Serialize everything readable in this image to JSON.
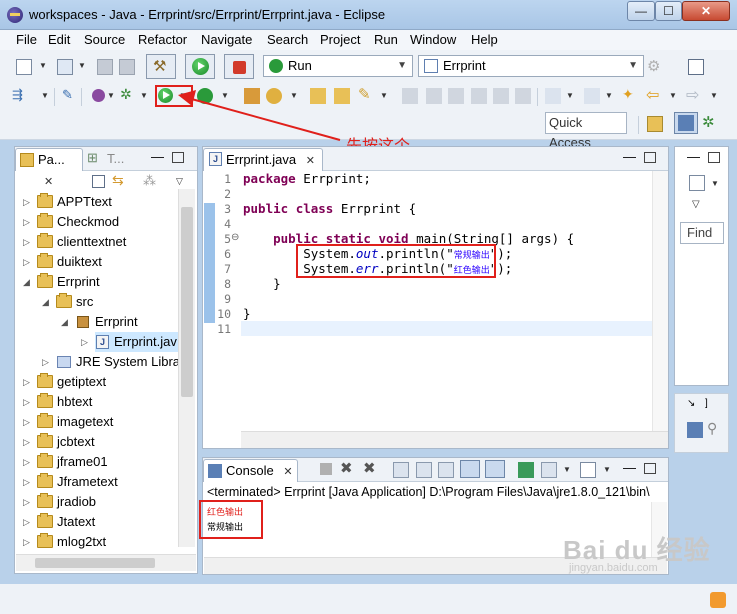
{
  "window": {
    "title": "workspaces - Java - Errprint/src/Errprint/Errprint.java - Eclipse",
    "min_glyph": "—",
    "max_glyph": "☐",
    "close_glyph": "✕"
  },
  "menubar": {
    "items": [
      "File",
      "Edit",
      "Source",
      "Refactor",
      "Navigate",
      "Search",
      "Project",
      "Run",
      "Window",
      "Help"
    ]
  },
  "toolbar": {
    "run_config_label": "Run",
    "launch_target_label": "Errprint",
    "quick_access_label": "Quick Access"
  },
  "package_explorer": {
    "tab_label": "Pa...",
    "secondary_tab_label": "T...",
    "items": [
      {
        "label": "APPTtext"
      },
      {
        "label": "Checkmod"
      },
      {
        "label": "clienttextnet"
      },
      {
        "label": "duiktext"
      },
      {
        "label": "Errprint"
      },
      {
        "label": "src"
      },
      {
        "label": "Errprint"
      },
      {
        "label": "Errprint.jav"
      },
      {
        "label": "JRE System Librar"
      },
      {
        "label": "getiptext"
      },
      {
        "label": "hbtext"
      },
      {
        "label": "imagetext"
      },
      {
        "label": "jcbtext"
      },
      {
        "label": "jframe01"
      },
      {
        "label": "Jframetext"
      },
      {
        "label": "jradiob"
      },
      {
        "label": "Jtatext"
      },
      {
        "label": "mlog2txt"
      }
    ]
  },
  "editor": {
    "tab_label": "Errprint.java",
    "line_numbers": [
      "1",
      "2",
      "3",
      "4",
      "5",
      "6",
      "7",
      "8",
      "9",
      "10",
      "11"
    ],
    "line1": {
      "kw": "package",
      "rest": " Errprint;"
    },
    "line3": {
      "kw1": "public",
      "kw2": "class",
      "rest": " Errprint {"
    },
    "line5": {
      "indent": "    ",
      "kw1": "public",
      "kw2": "static",
      "kw3": "void",
      "rest": " main(String[] args) {"
    },
    "line6": {
      "pre": "        System.",
      "field": "out",
      "mid": ".println(\"",
      "str": "常规输出",
      "post": "\");"
    },
    "line7": {
      "pre": "        System.",
      "field": "err",
      "mid": ".println(\"",
      "str": "红色输出",
      "post": "\");"
    },
    "line8": "    }",
    "line10": "}"
  },
  "outline": {
    "find_label": "Find"
  },
  "console": {
    "tab_label": "Console",
    "status": "<terminated> Errprint [Java Application] D:\\Program Files\\Java\\jre1.8.0_121\\bin\\",
    "err_line": "红色输出",
    "out_line": "常规输出"
  },
  "annotation": {
    "text": "先按这个",
    "color": "#e0201b"
  },
  "watermark": {
    "brand": "Bai du 经验",
    "url": "jingyan.baidu.com"
  },
  "colors": {
    "keyword": "#7f0055",
    "field": "#0000c0",
    "string": "#2a00ff",
    "stderr": "#e0201b",
    "run_green": "#198a2a"
  }
}
